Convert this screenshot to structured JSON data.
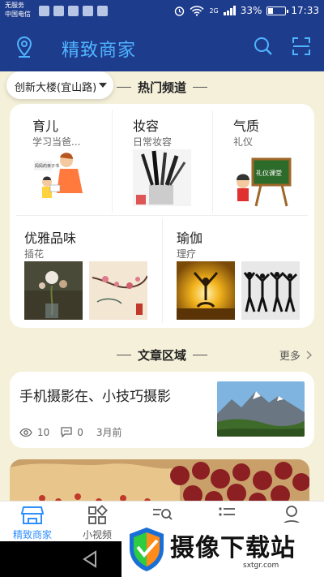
{
  "status_bar": {
    "carrier_line1": "无服务",
    "carrier_line2": "中国电信",
    "battery": "33%",
    "time": "17:33",
    "network": "2G"
  },
  "header": {
    "title": "精致商家"
  },
  "location": {
    "label": "创新大楼(宜山路)"
  },
  "hot_channels": {
    "title": "热门频道",
    "items": [
      {
        "name": "育儿",
        "sub": "学习当爸..."
      },
      {
        "name": "妆容",
        "sub": "日常妆容"
      },
      {
        "name": "气质",
        "sub": "礼仪"
      },
      {
        "name": "优雅品味",
        "sub": "插花"
      },
      {
        "name": "瑜伽",
        "sub": "理疗"
      }
    ],
    "parenting_book_text": "妈妈的亲子书",
    "etiquette_board_text": "礼仪课堂"
  },
  "articles": {
    "title": "文章区域",
    "more": "更多",
    "list": [
      {
        "title": "手机摄影在、小技巧摄影",
        "views": "10",
        "comments": "0",
        "time": "3月前"
      }
    ]
  },
  "tabbar": {
    "items": [
      {
        "label": "精致商家"
      },
      {
        "label": "小视频"
      }
    ]
  },
  "watermark": {
    "text": "摄像下载站",
    "url": "sxtgr.com"
  },
  "colors": {
    "header_bg": "#1e3c8c",
    "title_blue": "#4fb4ff",
    "page_bg": "#f5f0d9",
    "active_tab": "#2f8fff"
  }
}
